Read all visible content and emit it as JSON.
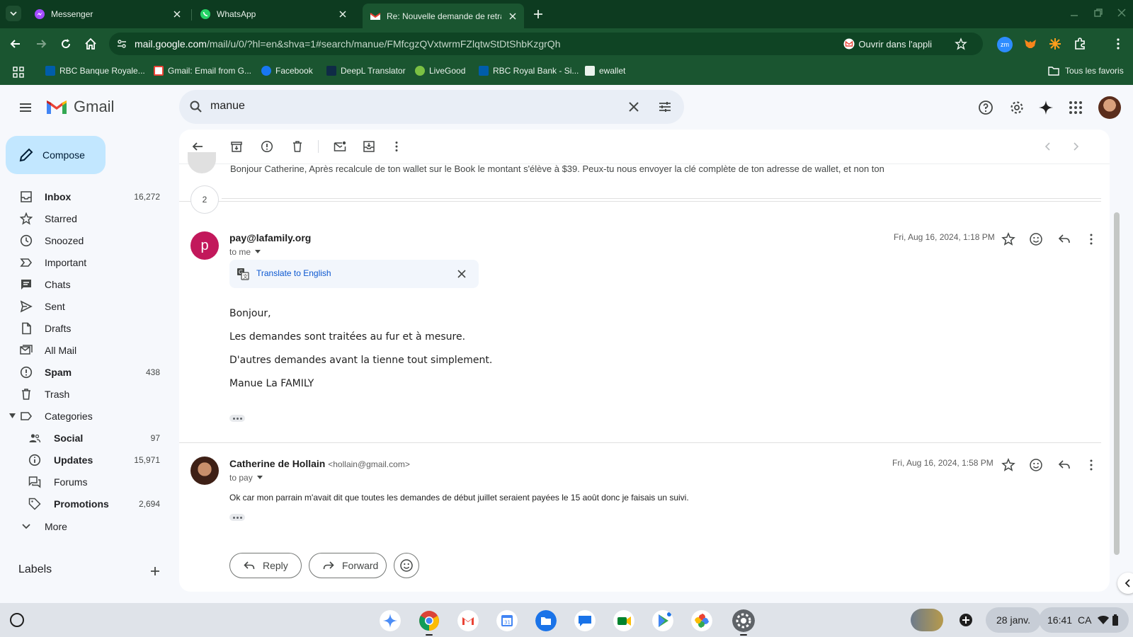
{
  "browser": {
    "tabs": [
      {
        "label": "Messenger",
        "active": false
      },
      {
        "label": "WhatsApp",
        "active": false
      },
      {
        "label": "Re: Nouvelle demande de retrai",
        "active": true
      }
    ],
    "url_host": "mail.google.com",
    "url_path": "/mail/u/0/?hl=en&shva=1#search/manue/FMfcgzQVxtwrmFZlqtwStDtShbKzgrQh",
    "open_in_app": "Ouvrir dans l'appli",
    "bookmarks": [
      "RBC Banque Royale...",
      "Gmail: Email from G...",
      "Facebook",
      "DeepL Translator",
      "LiveGood",
      "RBC Royal Bank - Si...",
      "ewallet"
    ],
    "all_bookmarks": "Tous les favoris"
  },
  "gmail": {
    "logo_text": "Gmail",
    "search_query": "manue",
    "compose": "Compose",
    "nav": [
      {
        "label": "Inbox",
        "count": "16,272"
      },
      {
        "label": "Starred",
        "count": ""
      },
      {
        "label": "Snoozed",
        "count": ""
      },
      {
        "label": "Important",
        "count": ""
      },
      {
        "label": "Chats",
        "count": ""
      },
      {
        "label": "Sent",
        "count": ""
      },
      {
        "label": "Drafts",
        "count": ""
      },
      {
        "label": "All Mail",
        "count": ""
      },
      {
        "label": "Spam",
        "count": "438"
      },
      {
        "label": "Trash",
        "count": ""
      },
      {
        "label": "Categories",
        "count": ""
      },
      {
        "label": "Social",
        "count": "97"
      },
      {
        "label": "Updates",
        "count": "15,971"
      },
      {
        "label": "Forums",
        "count": ""
      },
      {
        "label": "Promotions",
        "count": "2,694"
      },
      {
        "label": "More",
        "count": ""
      }
    ],
    "labels_header": "Labels"
  },
  "thread": {
    "collapsed_snippet": "Bonjour Catherine, Après recalcule de ton wallet sur le Book le montant s'élève à $39. Peux-tu nous envoyer la clé complète de ton adresse de wallet, et non ton",
    "hidden_count": "2",
    "message1": {
      "avatar_letter": "p",
      "sender": "pay@lafamily.org",
      "to": "to me",
      "date": "Fri, Aug 16, 2024, 1:18 PM",
      "translate": "Translate to English",
      "body": [
        "Bonjour,",
        "Les demandes sont traitées au fur et à mesure.",
        "D'autres demandes avant la tienne tout simplement.",
        "Manue La FAMILY"
      ]
    },
    "message2": {
      "sender": "Catherine de Hollain",
      "sender_email": "<hollain@gmail.com>",
      "to": "to pay",
      "date": "Fri, Aug 16, 2024, 1:58 PM",
      "body": "Ok car mon parrain m'avait dit que toutes les demandes de début juillet seraient payées le 15 août donc je faisais un suivi."
    },
    "reply": "Reply",
    "forward": "Forward"
  },
  "shelf": {
    "date": "28 janv.",
    "time": "16:41",
    "region": "CA"
  },
  "colors": {
    "chrome_dark": "#0d3b20",
    "chrome_toolbar": "#1a5530",
    "compose_bg": "#c2e7ff",
    "avatar_p": "#c2185b",
    "link_blue": "#0b57d0"
  }
}
